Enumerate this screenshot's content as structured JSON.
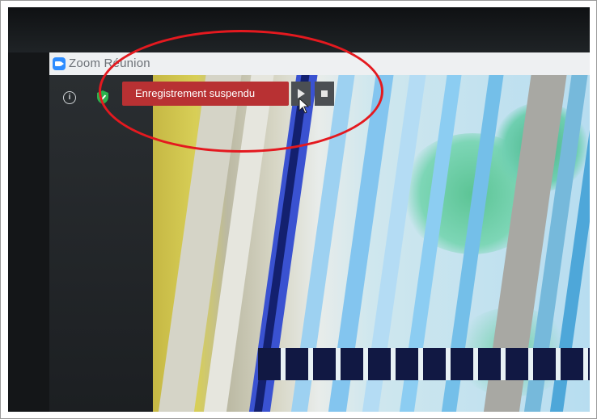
{
  "window": {
    "title": "Zoom Réunion"
  },
  "toolbar": {
    "info_icon": "info-icon",
    "encryption_icon": "shield-check-icon",
    "encryption_color": "#2bb24c"
  },
  "recording": {
    "status_label": "Enregistrement suspendu",
    "status_color": "#b83133",
    "resume_icon": "play-icon",
    "stop_icon": "stop-icon"
  },
  "annotation": {
    "color": "#e4191f"
  }
}
